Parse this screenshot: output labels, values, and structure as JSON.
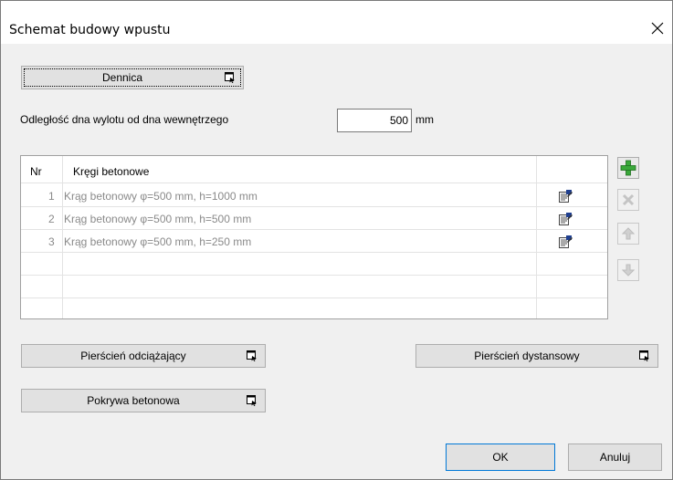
{
  "window": {
    "title": "Schemat budowy wpustu"
  },
  "buttons": {
    "dennica": "Dennica",
    "pierscien_odciazajacy": "Pierścień odciążający",
    "pierscien_dystansowy": "Pierścień dystansowy",
    "pokrywa_betonowa": "Pokrywa betonowa",
    "ok": "OK",
    "anuluj": "Anuluj"
  },
  "distance": {
    "label": "Odległość dna wylotu od dna wewnętrzego",
    "value": "500",
    "unit": "mm"
  },
  "grid": {
    "columns": {
      "nr": "Nr",
      "name": "Kręgi betonowe"
    },
    "rows": [
      {
        "nr": "1",
        "name": "Krąg betonowy φ=500 mm, h=1000 mm"
      },
      {
        "nr": "2",
        "name": "Krąg betonowy φ=500 mm, h=500 mm"
      },
      {
        "nr": "3",
        "name": "Krąg betonowy φ=500 mm, h=250 mm"
      }
    ]
  },
  "icons": {
    "close": "close-icon",
    "popup": "popup-arrow-icon",
    "edit": "edit-properties-icon",
    "add": "add-icon",
    "delete": "delete-icon",
    "move_up": "arrow-up-icon",
    "move_down": "arrow-down-icon"
  },
  "colors": {
    "add_green": "#3aa83a",
    "disabled_gray": "#b0b0b0",
    "dialog_bg": "#f0f0f0"
  }
}
